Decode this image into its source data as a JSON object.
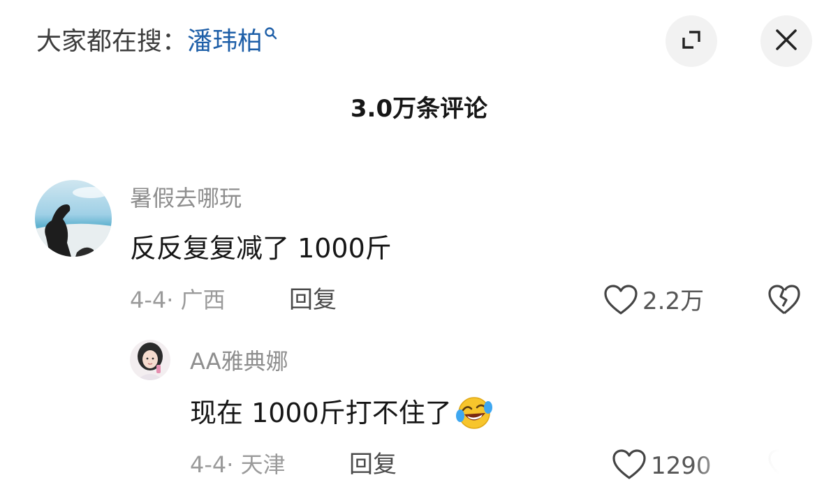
{
  "header": {
    "search_prefix": "大家都在搜：",
    "search_term": "潘玮柏",
    "search_icon": "search-icon",
    "expand_icon": "expand-icon",
    "close_icon": "close-icon"
  },
  "comment_count": "3.0万条评论",
  "comments": [
    {
      "username": "暑假去哪玩",
      "text": "反反复复减了 1000斤",
      "meta": "4-4· 广西",
      "reply_label": "回复",
      "likes": "2.2万",
      "avatar": "avatar-beach-silhouette",
      "replies": [
        {
          "username": "AA雅典娜",
          "text": "现在 1000斤打不住了",
          "emoji": "rolling-laughing-face",
          "meta": "4-4· 天津",
          "reply_label": "回复",
          "likes": "1290",
          "avatar": "avatar-girl-portrait"
        }
      ]
    }
  ],
  "colors": {
    "search_term": "#1e5fa8",
    "muted_text": "#8e8e8e",
    "button_bg": "#f2f2f2"
  }
}
